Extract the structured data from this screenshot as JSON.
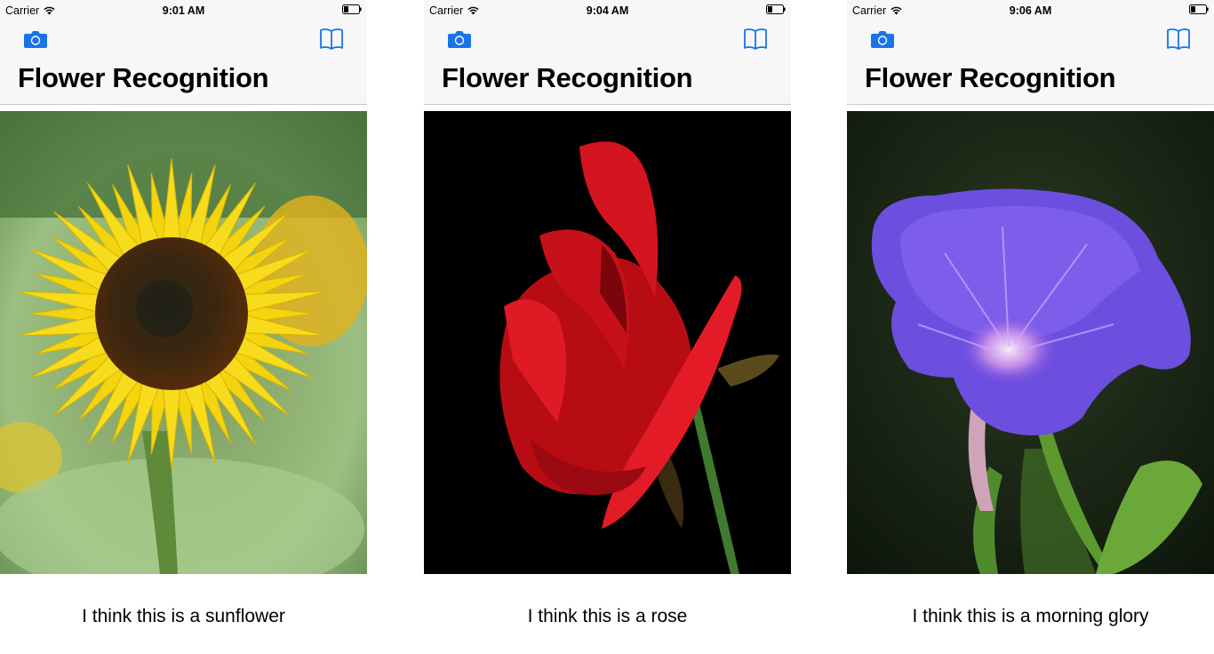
{
  "screens": [
    {
      "status": {
        "carrier": "Carrier",
        "time": "9:01 AM"
      },
      "title": "Flower Recognition",
      "result": "I think this is a sunflower",
      "photo": "sunflower"
    },
    {
      "status": {
        "carrier": "Carrier",
        "time": "9:04 AM"
      },
      "title": "Flower Recognition",
      "result": "I think this is a rose",
      "photo": "rose"
    },
    {
      "status": {
        "carrier": "Carrier",
        "time": "9:06 AM"
      },
      "title": "Flower Recognition",
      "result": "I think this is a morning glory",
      "photo": "morning-glory"
    }
  ],
  "icons": {
    "left": "camera-icon",
    "right": "book-icon",
    "status": [
      "wifi-icon",
      "battery-icon"
    ]
  },
  "colors": {
    "tint": "#1a73e8",
    "navbar_bg": "#f7f7f7"
  }
}
